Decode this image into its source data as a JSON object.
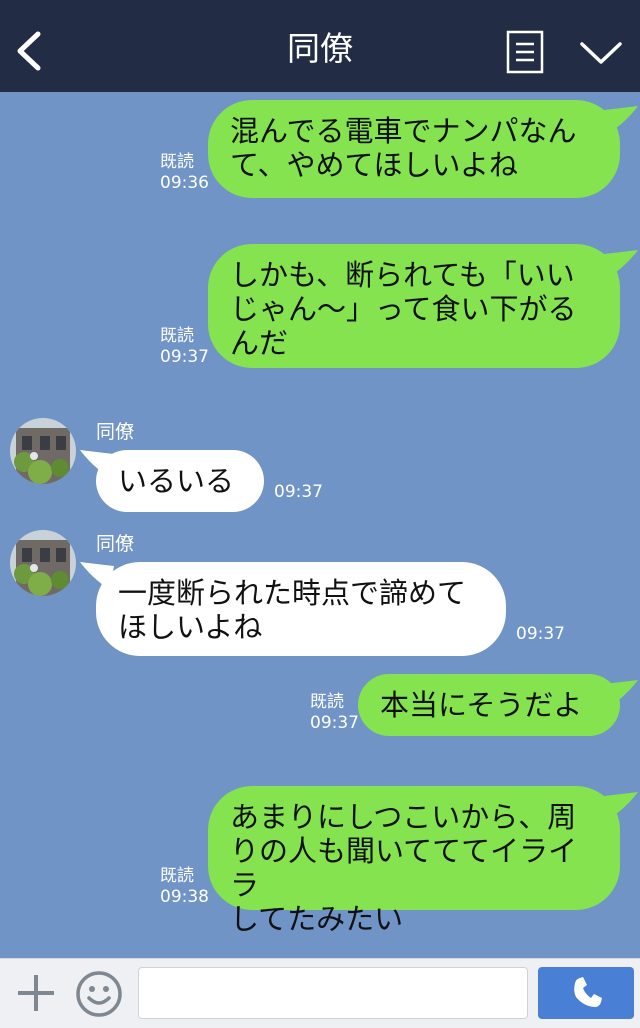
{
  "header": {
    "title": "同僚",
    "icons": {
      "back": "chevron-left-icon",
      "menu": "menu-list-icon",
      "collapse": "chevron-down-icon"
    }
  },
  "messages": [
    {
      "sender": "me",
      "lines": [
        "混んでる電車でナンパなん",
        "て、やめてほしいよね"
      ],
      "read": "既読",
      "time": "09:36"
    },
    {
      "sender": "me",
      "lines": [
        "しかも、断られても「いい",
        "じゃん〜」って食い下がる",
        "んだ"
      ],
      "read": "既読",
      "time": "09:37"
    },
    {
      "sender": "同僚",
      "lines": [
        "いるいる"
      ],
      "time": "09:37"
    },
    {
      "sender": "同僚",
      "lines": [
        "一度断られた時点で諦めて",
        "ほしいよね"
      ],
      "time": "09:37"
    },
    {
      "sender": "me",
      "lines": [
        "本当にそうだよ"
      ],
      "read": "既読",
      "time": "09:37"
    },
    {
      "sender": "me",
      "lines": [
        "あまりにしつこいから、周",
        "りの人も聞いてててイライラ",
        "してたみたい"
      ],
      "read": "既読",
      "time": "09:38"
    }
  ],
  "input_bar": {
    "placeholder": "",
    "icons": {
      "add": "plus-icon",
      "emoji": "smiley-icon",
      "call": "phone-icon"
    }
  },
  "colors": {
    "header_bg": "#232c45",
    "chat_bg": "#7094c6",
    "my_bubble": "#84e34f",
    "their_bubble": "#ffffff",
    "call_button": "#4a7fd6"
  }
}
